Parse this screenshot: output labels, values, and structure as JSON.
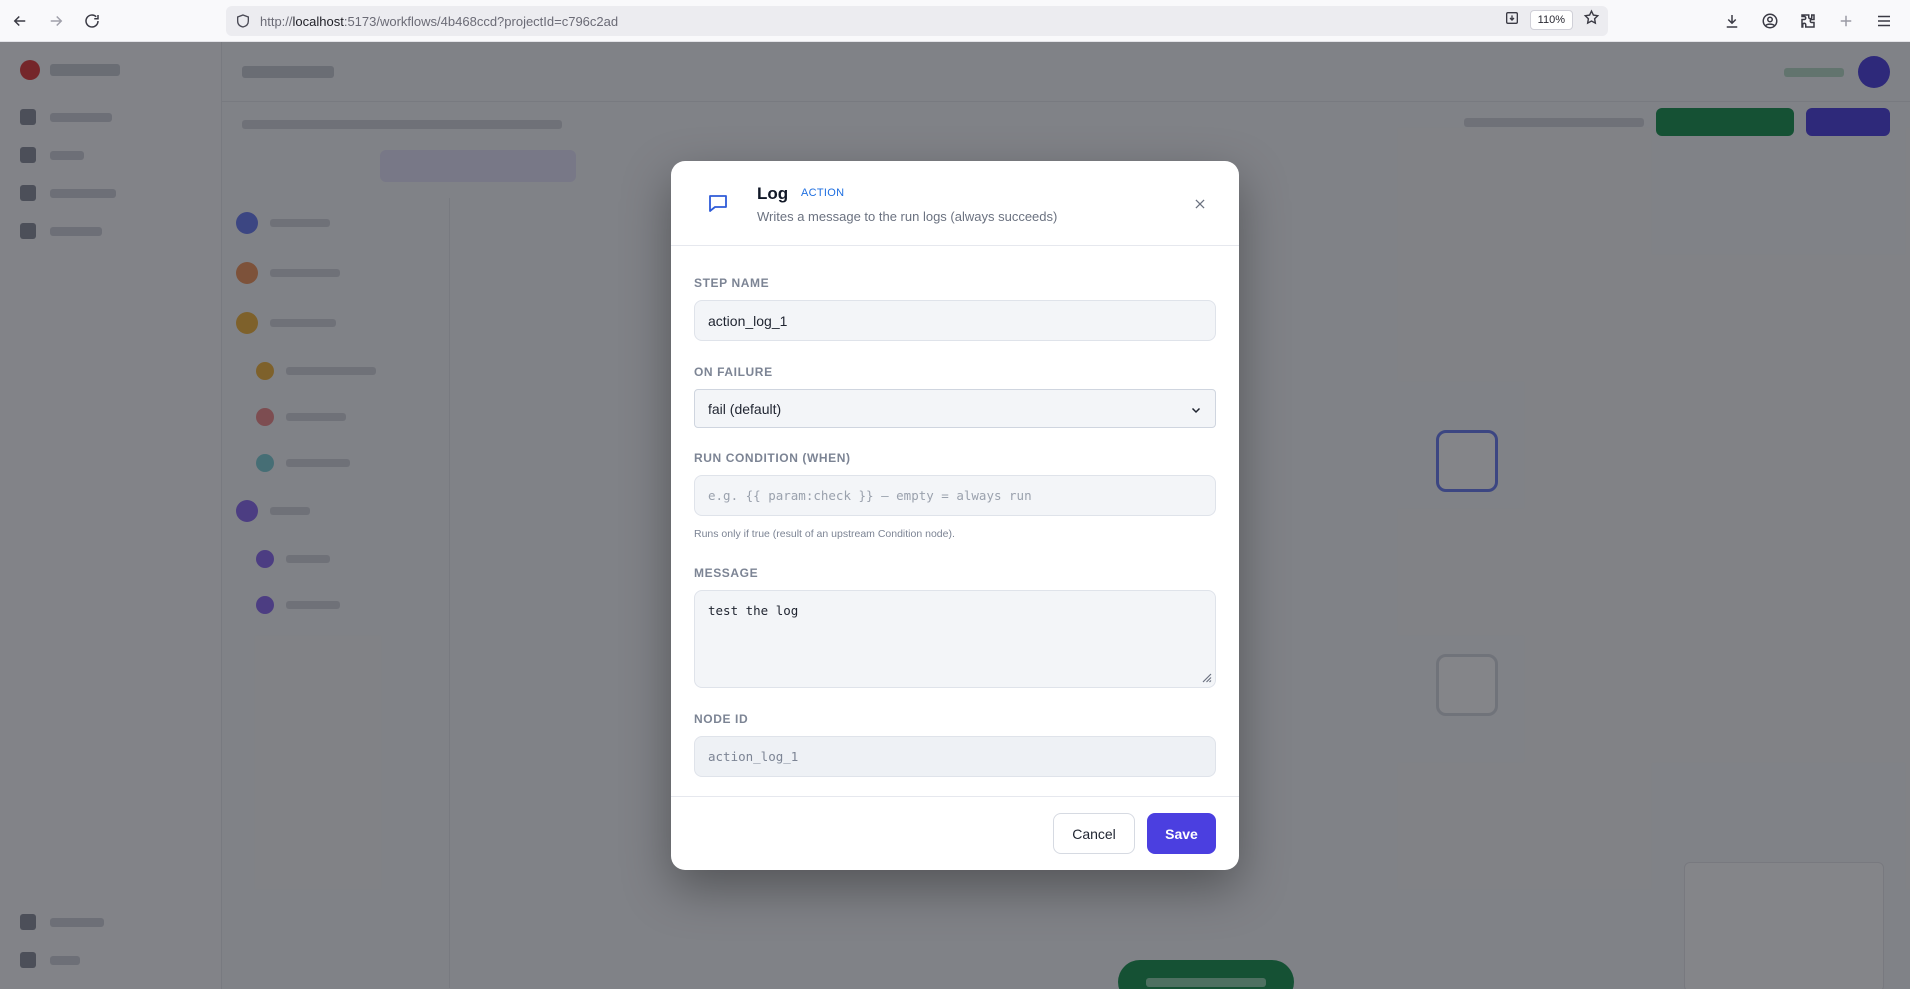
{
  "browser": {
    "url_prefix": "http://",
    "url_host": "localhost",
    "url_rest": ":5173/workflows/4b468ccd?projectId=c796c2ad",
    "zoom": "110%"
  },
  "modal": {
    "title": "Log",
    "badge": "ACTION",
    "subtitle": "Writes a message to the run logs (always succeeds)",
    "step_name": {
      "label": "STEP NAME",
      "value": "action_log_1"
    },
    "on_failure": {
      "label": "ON FAILURE",
      "selected": "fail (default)"
    },
    "run_condition": {
      "label": "RUN CONDITION (WHEN)",
      "placeholder": "e.g. {{ param:check }} — empty = always run",
      "value": "",
      "hint": "Runs only if true (result of an upstream Condition node)."
    },
    "message": {
      "label": "MESSAGE",
      "value": "test the log"
    },
    "node_id": {
      "label": "NODE ID",
      "value": "action_log_1"
    },
    "cancel_label": "Cancel",
    "save_label": "Save"
  },
  "colors": {
    "accent": "#4b3fe0",
    "badge": "#1f6fe0",
    "success": "#17924f"
  },
  "icons": {
    "back": "arrow-left-icon",
    "forward": "arrow-right-icon",
    "reload": "reload-icon",
    "shield": "shield-icon",
    "node": "message-square-icon",
    "close": "close-icon",
    "chevron": "chevron-down-icon"
  }
}
